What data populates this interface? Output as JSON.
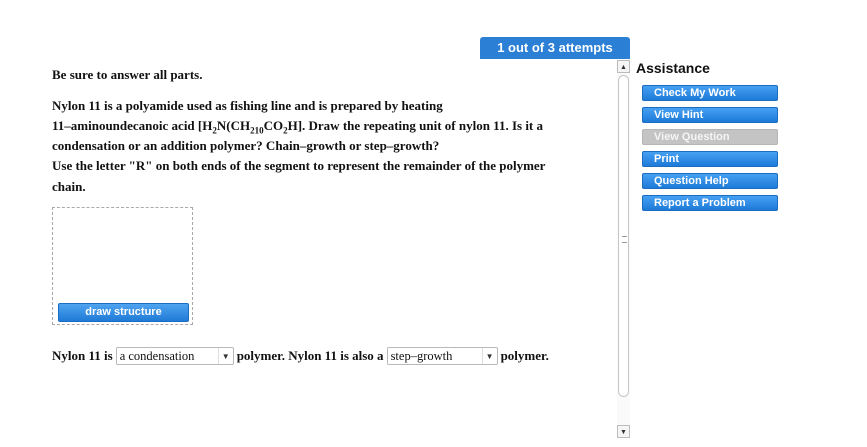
{
  "header": {
    "attempts_label": "1 out of 3 attempts"
  },
  "question": {
    "instruction": "Be sure to answer all parts.",
    "line1": "Nylon 11 is a polyamide used as fishing line and is prepared by heating",
    "line2_pre": "11–aminoundecanoic acid  [H",
    "sub_2a": "2",
    "line2_mid1": "N(CH",
    "sub_2b": "2",
    "sub_10": "10",
    "line2_mid2": "CO",
    "sub_2c": "2",
    "line2_post": "H].  Draw the repeating unit of nylon 11. Is it a",
    "line3": "condensation or an addition polymer? Chain–growth or step–growth?",
    "line4": "Use the letter \"R\" on both ends of the segment to represent the remainder of the polymer",
    "line5": "chain."
  },
  "draw": {
    "button_label": "draw structure"
  },
  "answer": {
    "text1": "Nylon 11 is",
    "select1_value": "a condensation",
    "text2": "polymer. Nylon 11 is also a",
    "select2_value": "step–growth",
    "text3": "polymer."
  },
  "assistance": {
    "title": "Assistance",
    "buttons": [
      {
        "label": "Check My Work",
        "enabled": true
      },
      {
        "label": "View Hint",
        "enabled": true
      },
      {
        "label": "View Question",
        "enabled": false
      },
      {
        "label": "Print",
        "enabled": true
      },
      {
        "label": "Question Help",
        "enabled": true
      },
      {
        "label": "Report a Problem",
        "enabled": true
      }
    ]
  },
  "colors": {
    "accent": "#2b7fd4",
    "disabled": "#c4c4c4"
  }
}
